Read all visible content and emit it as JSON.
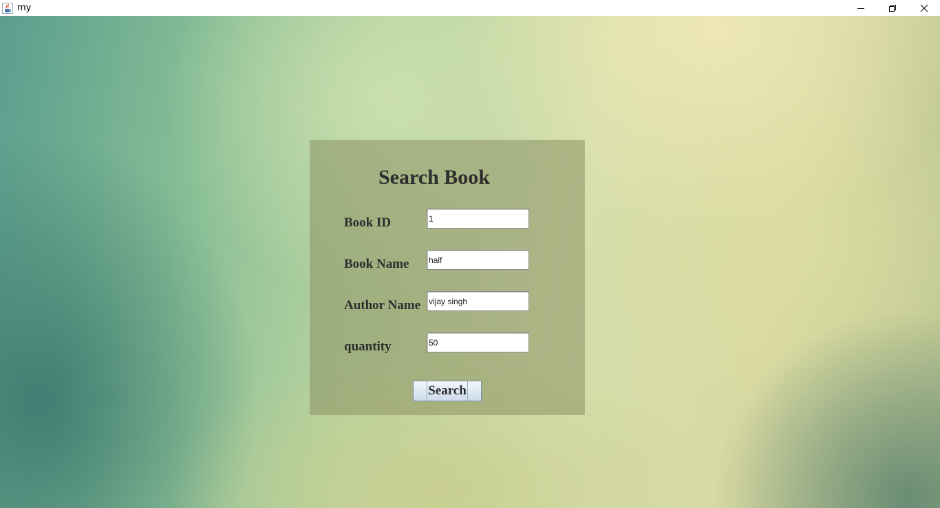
{
  "window": {
    "title": "my"
  },
  "form": {
    "heading": "Search Book",
    "fields": [
      {
        "label": "Book ID",
        "value": "1"
      },
      {
        "label": "Book Name",
        "value": "half"
      },
      {
        "label": "Author Name",
        "value": "vijay singh"
      },
      {
        "label": "quantity",
        "value": "50"
      }
    ],
    "search_label": "Search"
  },
  "icons": {
    "app": "java-cup-icon",
    "minimize": "minimize-icon",
    "restore": "restore-icon",
    "close": "close-icon"
  }
}
